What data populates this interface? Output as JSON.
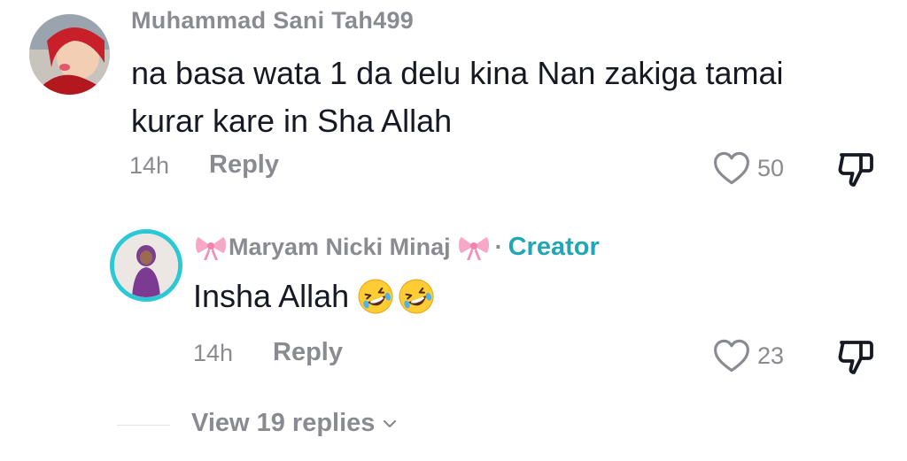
{
  "comments": [
    {
      "username": "Muhammad Sani Tah499",
      "text": "na basa wata 1 da delu kina Nan zakiga tamai kurar kare in Sha Allah",
      "time": "14h",
      "reply_label": "Reply",
      "likes": "50"
    }
  ],
  "reply": {
    "username": "Maryam Nicki Minaj",
    "separator": "·",
    "badge": "Creator",
    "text": "Insha Allah",
    "time": "14h",
    "reply_label": "Reply",
    "likes": "23"
  },
  "view_replies": {
    "label": "View 19 replies"
  },
  "colors": {
    "text_primary": "#161823",
    "text_secondary": "#8a8b91",
    "creator_accent": "#20a6b4",
    "avatar_ring": "#2dc8d6"
  },
  "icons": {
    "like": "heart-outline-icon",
    "dislike": "thumbs-down-outline-icon",
    "expand": "chevron-down-icon",
    "bow": "pink-ribbon-bow-emoji",
    "emoji": "rolling-on-floor-laughing-emoji"
  }
}
